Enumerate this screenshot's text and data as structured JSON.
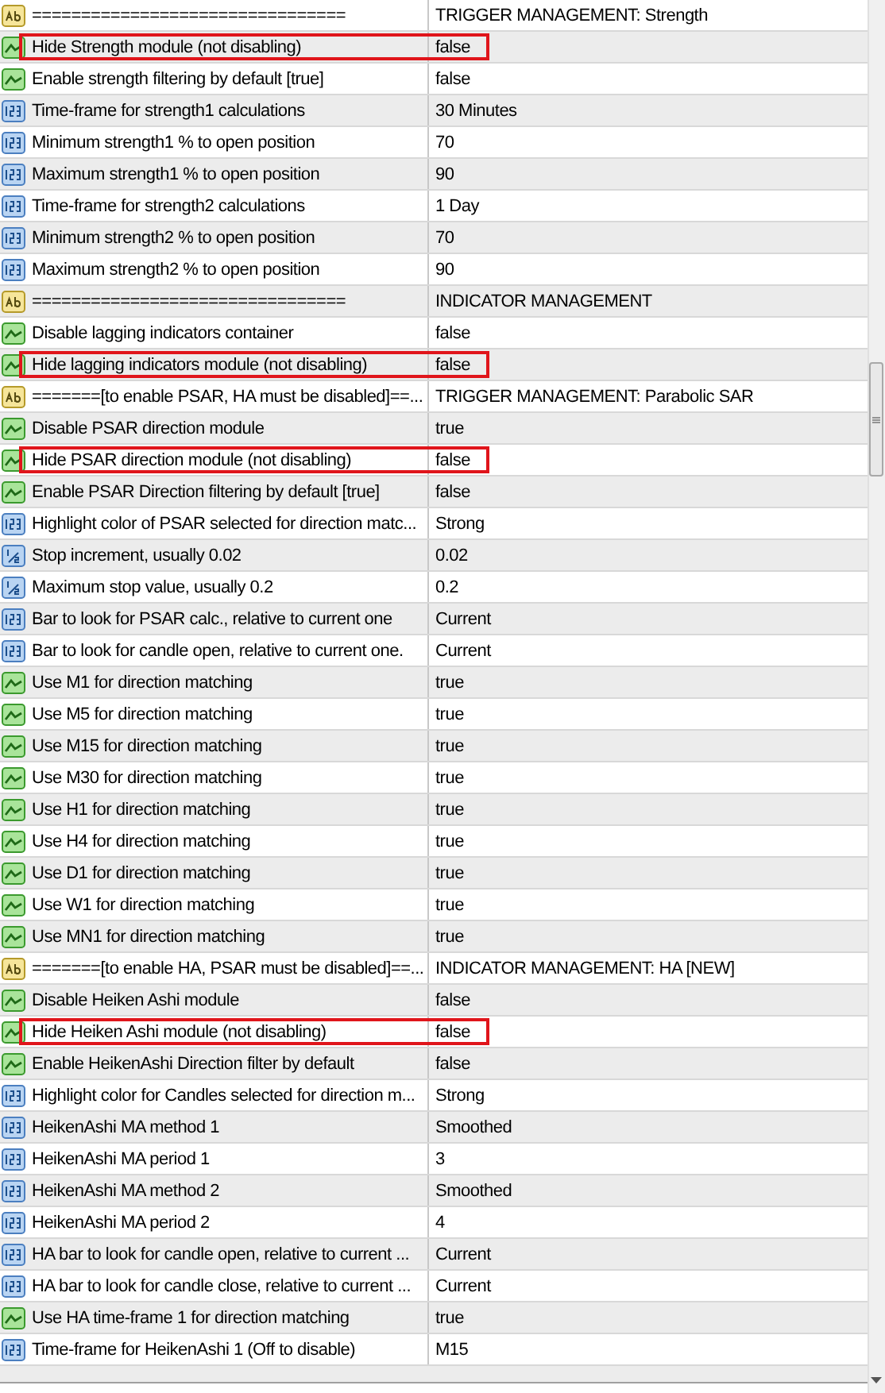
{
  "inputs": {
    "rows": [
      {
        "kind": "string",
        "name": "================================",
        "value": "TRIGGER MANAGEMENT: Strength",
        "highlighted": false
      },
      {
        "kind": "bool",
        "name": "Hide Strength module (not disabling)",
        "value": "false",
        "highlighted": true
      },
      {
        "kind": "bool",
        "name": "Enable strength filtering by default [true]",
        "value": "false",
        "highlighted": false
      },
      {
        "kind": "int",
        "name": "Time-frame for strength1 calculations",
        "value": "30 Minutes",
        "highlighted": false
      },
      {
        "kind": "int",
        "name": "Minimum strength1 % to open position",
        "value": "70",
        "highlighted": false
      },
      {
        "kind": "int",
        "name": "Maximum strength1 % to open position",
        "value": "90",
        "highlighted": false
      },
      {
        "kind": "int",
        "name": "Time-frame for strength2 calculations",
        "value": "1 Day",
        "highlighted": false
      },
      {
        "kind": "int",
        "name": "Minimum strength2 % to open position",
        "value": "70",
        "highlighted": false
      },
      {
        "kind": "int",
        "name": "Maximum strength2 % to open position",
        "value": "90",
        "highlighted": false
      },
      {
        "kind": "string",
        "name": "================================",
        "value": "INDICATOR MANAGEMENT",
        "highlighted": false
      },
      {
        "kind": "bool",
        "name": "Disable lagging indicators container",
        "value": "false",
        "highlighted": false
      },
      {
        "kind": "bool",
        "name": "Hide lagging indicators module (not disabling)",
        "value": "false",
        "highlighted": true
      },
      {
        "kind": "string",
        "name": "=======[to enable PSAR, HA must be disabled]==...",
        "value": "TRIGGER MANAGEMENT: Parabolic SAR",
        "highlighted": false
      },
      {
        "kind": "bool",
        "name": "Disable PSAR direction module",
        "value": "true",
        "highlighted": false
      },
      {
        "kind": "bool",
        "name": "Hide PSAR direction module (not disabling)",
        "value": "false",
        "highlighted": true
      },
      {
        "kind": "bool",
        "name": "Enable PSAR Direction filtering by default [true]",
        "value": "false",
        "highlighted": false
      },
      {
        "kind": "int",
        "name": "Highlight color of PSAR selected for direction matc...",
        "value": "Strong",
        "highlighted": false
      },
      {
        "kind": "double",
        "name": "Stop increment, usually 0.02",
        "value": "0.02",
        "highlighted": false
      },
      {
        "kind": "double",
        "name": "Maximum stop value, usually 0.2",
        "value": "0.2",
        "highlighted": false
      },
      {
        "kind": "int",
        "name": "Bar to look for PSAR calc., relative to current one",
        "value": "Current",
        "highlighted": false
      },
      {
        "kind": "int",
        "name": "Bar to look for candle open, relative to current one.",
        "value": "Current",
        "highlighted": false
      },
      {
        "kind": "bool",
        "name": "Use M1 for direction matching",
        "value": "true",
        "highlighted": false
      },
      {
        "kind": "bool",
        "name": "Use M5 for direction matching",
        "value": "true",
        "highlighted": false
      },
      {
        "kind": "bool",
        "name": "Use M15 for direction matching",
        "value": "true",
        "highlighted": false
      },
      {
        "kind": "bool",
        "name": "Use M30 for direction matching",
        "value": "true",
        "highlighted": false
      },
      {
        "kind": "bool",
        "name": "Use H1 for direction matching",
        "value": "true",
        "highlighted": false
      },
      {
        "kind": "bool",
        "name": "Use H4 for direction matching",
        "value": "true",
        "highlighted": false
      },
      {
        "kind": "bool",
        "name": "Use D1 for direction matching",
        "value": "true",
        "highlighted": false
      },
      {
        "kind": "bool",
        "name": "Use W1 for direction matching",
        "value": "true",
        "highlighted": false
      },
      {
        "kind": "bool",
        "name": "Use MN1 for direction matching",
        "value": "true",
        "highlighted": false
      },
      {
        "kind": "string",
        "name": "=======[to enable HA, PSAR must be disabled]==...",
        "value": "INDICATOR MANAGEMENT: HA [NEW]",
        "highlighted": false
      },
      {
        "kind": "bool",
        "name": "Disable Heiken Ashi module",
        "value": "false",
        "highlighted": false
      },
      {
        "kind": "bool",
        "name": "Hide Heiken Ashi module (not disabling)",
        "value": "false",
        "highlighted": true
      },
      {
        "kind": "bool",
        "name": "Enable HeikenAshi Direction filter by default",
        "value": "false",
        "highlighted": false
      },
      {
        "kind": "int",
        "name": "Highlight color for Candles selected for direction m...",
        "value": "Strong",
        "highlighted": false
      },
      {
        "kind": "int",
        "name": "HeikenAshi MA method 1",
        "value": "Smoothed",
        "highlighted": false
      },
      {
        "kind": "int",
        "name": "HeikenAshi MA period 1",
        "value": "3",
        "highlighted": false
      },
      {
        "kind": "int",
        "name": "HeikenAshi MA method 2",
        "value": "Smoothed",
        "highlighted": false
      },
      {
        "kind": "int",
        "name": "HeikenAshi MA period 2",
        "value": "4",
        "highlighted": false
      },
      {
        "kind": "int",
        "name": "HA bar to look for candle open, relative to current ...",
        "value": "Current",
        "highlighted": false
      },
      {
        "kind": "int",
        "name": "HA bar to look for candle close, relative to current ...",
        "value": "Current",
        "highlighted": false
      },
      {
        "kind": "bool",
        "name": "Use HA time-frame 1 for direction matching",
        "value": "true",
        "highlighted": false
      },
      {
        "kind": "int",
        "name": "Time-frame for HeikenAshi 1 (Off to disable)",
        "value": "M15",
        "highlighted": false
      }
    ]
  }
}
